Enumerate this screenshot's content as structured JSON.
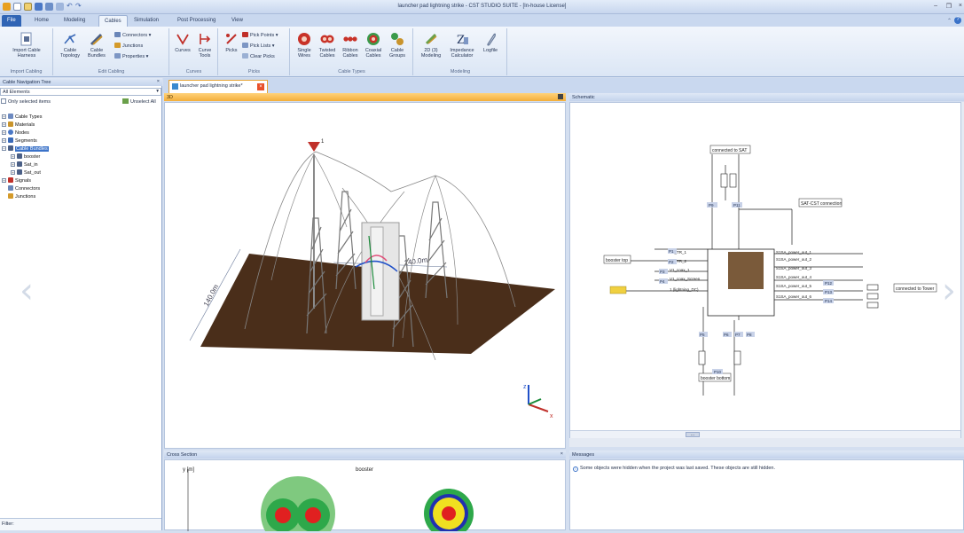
{
  "window": {
    "title": "launcher pad lightning strike - CST STUDIO SUITE - [In-house License]"
  },
  "menu_tabs": [
    "File",
    "Home",
    "Modeling",
    "Cables",
    "Simulation",
    "Post Processing",
    "View"
  ],
  "ribbon": {
    "import_cabling": {
      "label": "Import Cabling",
      "import_button": "Import Cable Harness"
    },
    "edit_cabling": {
      "label": "Edit Cabling",
      "topology": "Cable Topology",
      "bundles": "Cable Bundles",
      "connectors": "Connectors",
      "junctions": "Junctions",
      "properties": "Properties"
    },
    "curves": {
      "label": "Curves",
      "curves": "Curves",
      "curve_tools": "Curve Tools"
    },
    "picks": {
      "label": "Picks",
      "picks": "Picks",
      "pick_points": "Pick Points",
      "pick_lists": "Pick Lists",
      "clear_picks": "Clear Picks"
    },
    "cable_types": {
      "label": "Cable Types",
      "single": "Single Wires",
      "twisted": "Twisted Cables",
      "ribbon": "Ribbon Cables",
      "coaxial": "Coaxial Cables",
      "groups": "Cable Groups"
    },
    "modeling": {
      "label": "Modeling",
      "modeling_2d3d": "2D (3) Modeling",
      "impedance": "Impedance Calculator",
      "logfile": "Logfile"
    }
  },
  "nav_tree": {
    "title": "Cable Navigation Tree",
    "filter_value": "All Elements",
    "only_selected": "Only selected items",
    "unselect_all": "Unselect All",
    "items": [
      "Cable Types",
      "Materials",
      "Nodes",
      "Segments",
      "Cable Bundles",
      "booster",
      "Sat_in",
      "Sat_out",
      "Signals",
      "Connectors",
      "Junctions"
    ],
    "filter_label": "Filter:"
  },
  "doc_tab": "launcher pad lightning strike*",
  "panels": {
    "view3d": "3D",
    "schematic": "Schematic",
    "cross_section": "Cross Section",
    "messages": "Messages"
  },
  "view3d": {
    "dim_left": "140.0m",
    "dim_right": "140.0m",
    "axis_z": "z",
    "axis_x": "x",
    "marker": "1"
  },
  "schematic": {
    "labels": [
      "connected to SAT",
      "SAT-CST connection",
      "booster top",
      "connected to Tower",
      "booster bottom"
    ],
    "pins": [
      "P9",
      "P11",
      "P1",
      "P2",
      "P3",
      "P4",
      "P10",
      "P12",
      "P13",
      "P14",
      "P5",
      "P6",
      "P7",
      "P8"
    ],
    "block_pins": [
      "V1_TR_1",
      "V1_TR_2",
      "V1_coax_1",
      "V1_coax_Screen",
      "1 (lightning_DC)",
      "S1SA_power_out_1",
      "S1SA_power_out_2",
      "S1SA_power_out_3",
      "S1SA_power_out_4",
      "S1SA_power_out_5",
      "S1SA_power_out_6"
    ],
    "scroll_btn": "..."
  },
  "cross_section": {
    "ylabel": "y [m]",
    "title": "booster"
  },
  "messages": {
    "text": "Some objects were hidden when the project was last saved. These objects are still hidden."
  },
  "colors": {
    "accent": "#2f64b5",
    "active_header": "#f3ae3a",
    "ground": "#4a2e1a"
  }
}
